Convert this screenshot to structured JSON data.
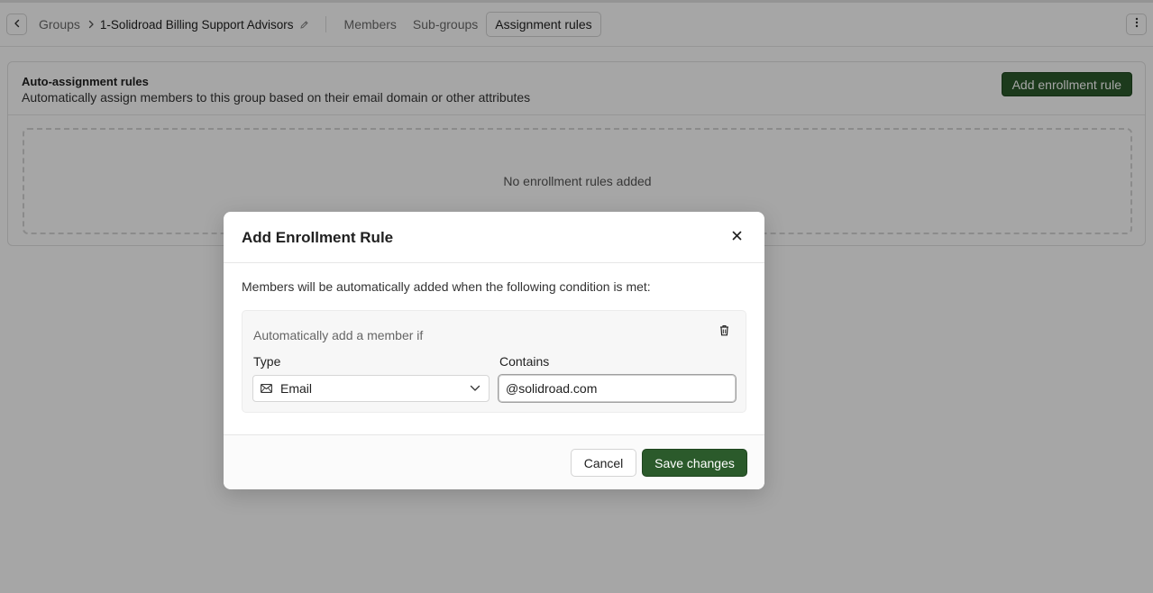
{
  "header": {
    "breadcrumb_groups": "Groups",
    "group_name": "1-Solidroad Billing Support Advisors",
    "tabs": [
      {
        "label": "Members",
        "active": false
      },
      {
        "label": "Sub-groups",
        "active": false
      },
      {
        "label": "Assignment rules",
        "active": true
      }
    ]
  },
  "card": {
    "title": "Auto-assignment rules",
    "subtitle": "Automatically assign members to this group based on their email domain or other attributes",
    "add_button": "Add enrollment rule",
    "empty_text": "No enrollment rules added"
  },
  "modal": {
    "title": "Add Enrollment Rule",
    "description": "Members will be automatically added when the following condition is met:",
    "condition_label": "Automatically add a member if",
    "type_label": "Type",
    "type_value": "Email",
    "contains_label": "Contains",
    "contains_value": "@solidroad.com",
    "cancel_button": "Cancel",
    "save_button": "Save changes"
  },
  "colors": {
    "primary_green": "#2b5a2b",
    "overlay": "rgba(0,0,0,0.35)"
  },
  "icons": {
    "back": "chevron-left-icon",
    "breadcrumb_separator": "chevron-right-icon",
    "edit": "pencil-icon",
    "more": "more-vertical-icon",
    "close": "close-icon",
    "delete": "trash-icon",
    "type": "mail-icon",
    "dropdown": "chevron-down-icon"
  }
}
